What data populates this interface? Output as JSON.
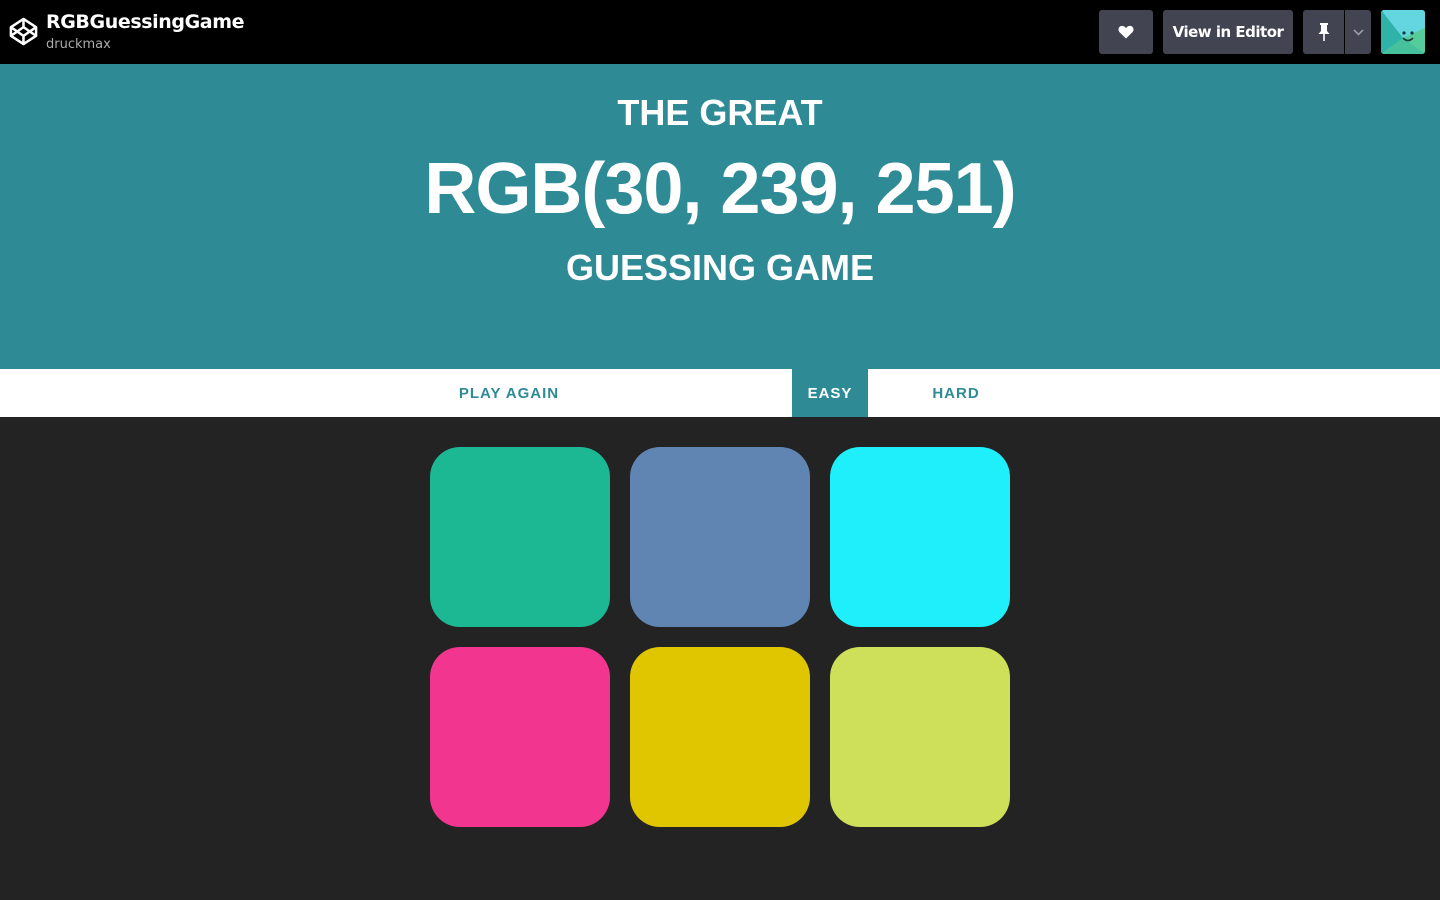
{
  "topbar": {
    "title": "RGBGuessingGame",
    "author": "druckmax",
    "view_in_editor_label": "View in Editor",
    "icons": [
      "codepen-logo-icon",
      "heart-icon",
      "pin-icon",
      "chevron-down-icon",
      "avatar"
    ]
  },
  "header": {
    "line_top": "THE GREAT",
    "rgb_display": "RGB(30, 239, 251)",
    "line_bottom": "GUESSING GAME"
  },
  "stripe": {
    "play_again_label": "PLAY AGAIN",
    "easy_label": "EASY",
    "hard_label": "HARD",
    "active_mode": "EASY"
  },
  "squares": [
    {
      "color": "#1cb893"
    },
    {
      "color": "#6085b2"
    },
    {
      "color": "#1eeffb"
    },
    {
      "color": "#f2358e"
    },
    {
      "color": "#dfc600"
    },
    {
      "color": "#cedf59"
    }
  ],
  "colors": {
    "accent": "#2e8b96",
    "background": "#232323",
    "topbar": "#000000",
    "button": "#434452"
  }
}
